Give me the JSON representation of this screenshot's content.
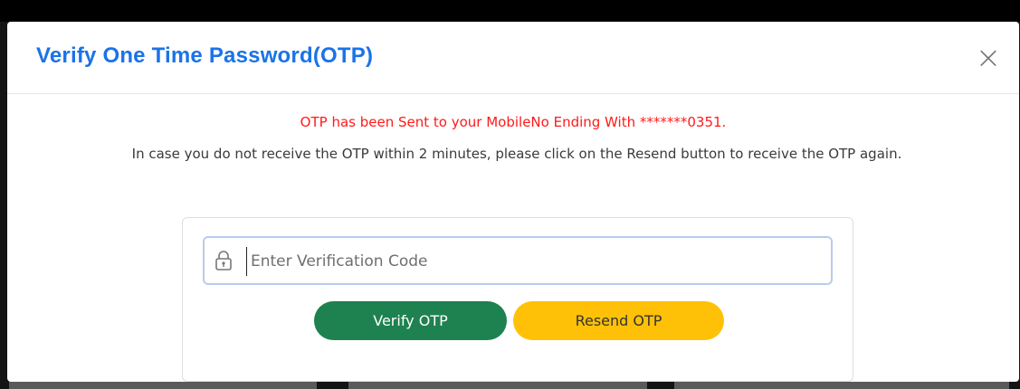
{
  "modal": {
    "title": "Verify One Time Password(OTP)",
    "close_label": "×"
  },
  "messages": {
    "sent_notice": "OTP has been Sent to your MobileNo Ending With *******0351.",
    "resend_info": "In case you do not receive the OTP within 2 minutes, please click on the Resend button to receive the OTP again."
  },
  "otp_form": {
    "input_placeholder": "Enter Verification Code",
    "input_value": "",
    "icon": "lock-icon",
    "verify_label": "Verify OTP",
    "resend_label": "Resend OTP"
  },
  "colors": {
    "title": "#1a73e8",
    "notice": "#ff1a1a",
    "verify_button": "#1e8150",
    "resend_button": "#ffc107"
  }
}
